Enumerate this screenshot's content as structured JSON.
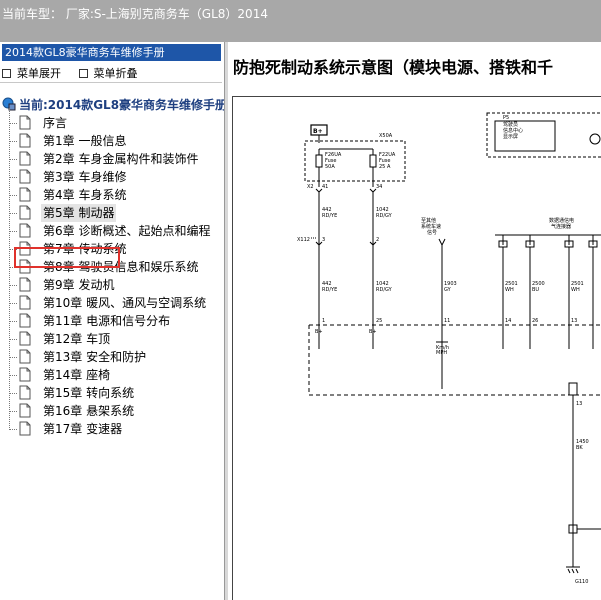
{
  "window": {
    "title": "当前车型：  厂家:S-上海别克商务车（GL8）2014"
  },
  "left_panel": {
    "header": "2014款GL8豪华商务车维修手册",
    "expand_label": "菜单展开",
    "collapse_label": "菜单折叠",
    "root_label": "当前:2014款GL8豪华商务车维修手册",
    "items": [
      {
        "label": "序言"
      },
      {
        "label": "第1章  一般信息"
      },
      {
        "label": "第2章  车身金属构件和装饰件"
      },
      {
        "label": "第3章  车身维修"
      },
      {
        "label": "第4章  车身系统"
      },
      {
        "label": "第5章  制动器"
      },
      {
        "label": "第6章  诊断概述、起始点和编程"
      },
      {
        "label": "第7章  传动系统"
      },
      {
        "label": "第8章  驾驶员信息和娱乐系统"
      },
      {
        "label": "第9章  发动机"
      },
      {
        "label": "第10章  暖风、通风与空调系统"
      },
      {
        "label": "第11章  电源和信号分布"
      },
      {
        "label": "第12章  车顶"
      },
      {
        "label": "第13章  安全和防护"
      },
      {
        "label": "第14章  座椅"
      },
      {
        "label": "第15章  转向系统"
      },
      {
        "label": "第16章  悬架系统"
      },
      {
        "label": "第17章  变速器"
      }
    ],
    "selected_index": 5
  },
  "content": {
    "title": "防抱死制动系统示意图（模块电源、搭铁和千",
    "diagram": {
      "bplus": "B+",
      "x50a": "X50A",
      "f26": {
        "line1": "F26UA",
        "line2": "Fuse",
        "line3": "50A"
      },
      "f22": {
        "line1": "F22UA",
        "line2": "Fuse",
        "line3": "25 A"
      },
      "pin_x2": "X2",
      "pin_41": "41",
      "pin_34": "34",
      "w442a": {
        "num": "442",
        "color": "RD/YE"
      },
      "w1042a": {
        "num": "1042",
        "color": "RD/GY"
      },
      "x112": "X112",
      "pin_3": "3",
      "pin_2": "2",
      "w442b": {
        "num": "442",
        "color": "RD/YE"
      },
      "w1042b": {
        "num": "1042",
        "color": "RD/GY"
      },
      "pin_1": "1",
      "pin_25": "25",
      "bplus_1": "B+",
      "bplus_2": "B+",
      "p5_label": "P5",
      "p5_line1": "驾驶员",
      "p5_line2": "信息中心",
      "p5_line3": "显示屏",
      "speed_line1": "至其他",
      "speed_line2": "系统车速",
      "speed_line3": "信号",
      "serial_line1": "数据通信电",
      "serial_line2": "气连接器",
      "w1903": {
        "num": "1903",
        "color": "GY"
      },
      "pin_11": "11",
      "kmh": "Km/h",
      "mph": "MPH",
      "w2501a": {
        "num": "2501",
        "color": "WH"
      },
      "w2500": {
        "num": "2500",
        "color": "BU"
      },
      "w2501b": {
        "num": "2501",
        "color": "WH"
      },
      "pin_14": "14",
      "pin_26": "26",
      "pin_13a": "13",
      "pin_13b": "13",
      "w1450": {
        "num": "1450",
        "color": "BK"
      },
      "g110": "G110"
    }
  }
}
